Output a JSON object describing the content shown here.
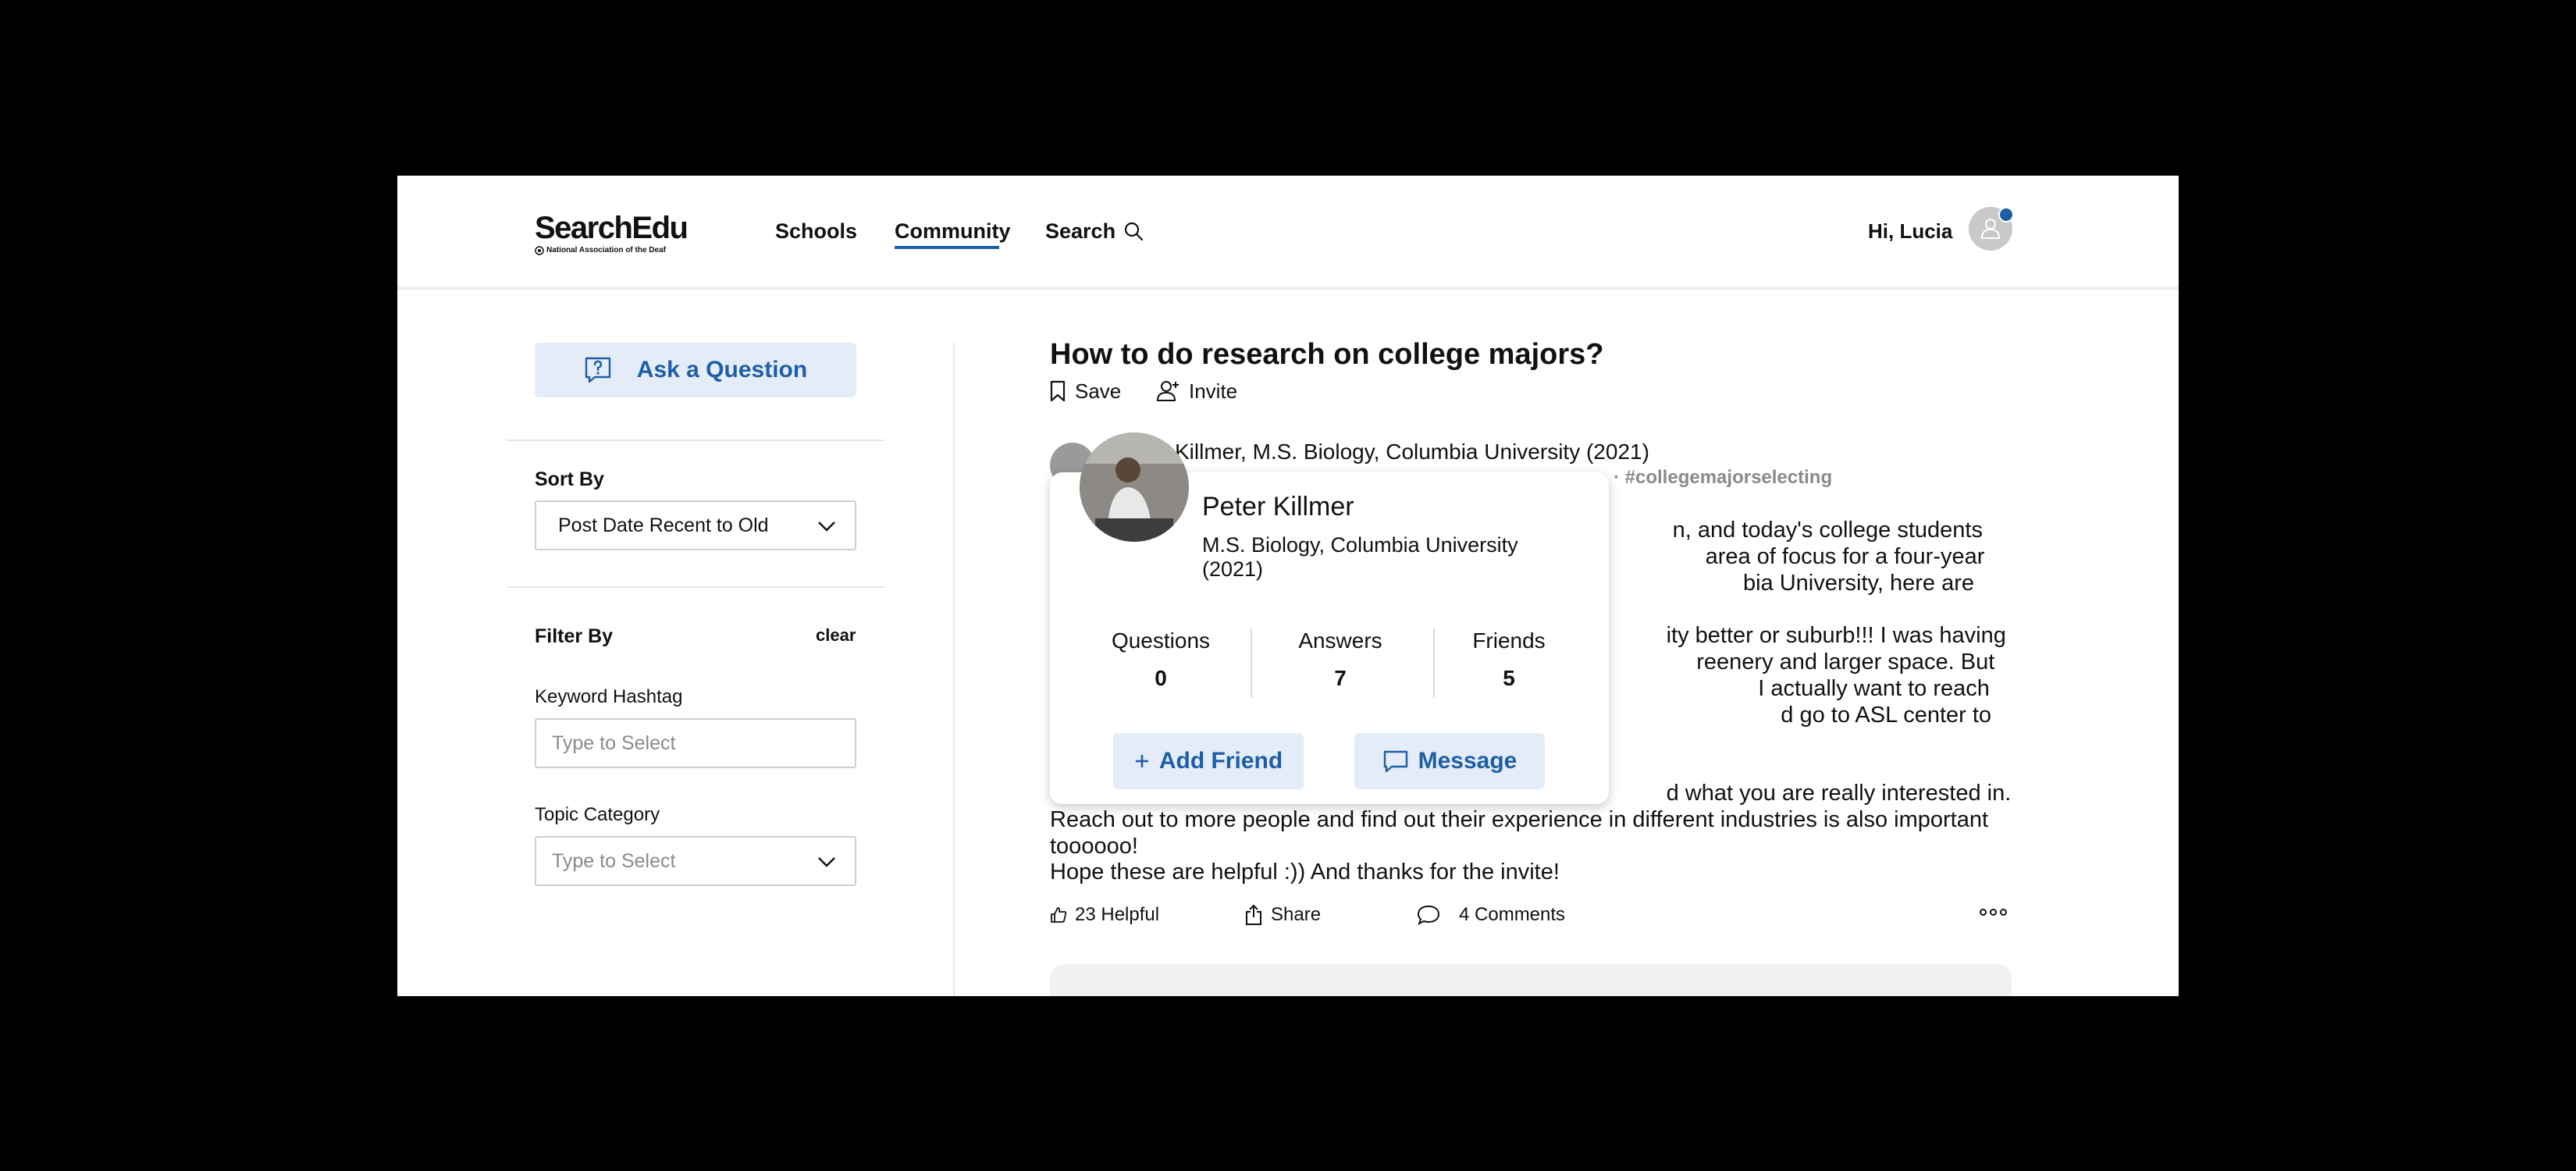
{
  "header": {
    "logo_title": "SearchEdu",
    "logo_subtitle": "National Association of the Deaf",
    "nav": {
      "schools": "Schools",
      "community": "Community",
      "search": "Search"
    },
    "greeting": "Hi, Lucia"
  },
  "sidebar": {
    "ask_label": "Ask a Question",
    "sort_label": "Sort By",
    "sort_value": "Post Date Recent to Old",
    "filter_label": "Filter By",
    "clear_label": "clear",
    "keyword_label": "Keyword Hashtag",
    "keyword_placeholder": "Type to Select",
    "topic_label": "Topic Category",
    "topic_placeholder": "Type to Select"
  },
  "post": {
    "title": "How to do research on college majors?",
    "save_label": "Save",
    "invite_label": "Invite",
    "author_line": "Killmer, M.S. Biology, Columbia University (2021)",
    "tag_line": "· #collegemajorselecting",
    "paragraph1": "                                                                                                   n, and today's college students are                                                                                                   area of focus for a four-year degree                                                                                                   bia University, here are some tips!!!",
    "paragraph2": "                                                                                                  ity better or suburb!!! I was having my                                                                                                  reenery and larger space. But not until I                                                                                                  I actually want to reach out to more                                                                                                  d go to ASL center to chat with friends",
    "paragraph3": "                                                                                                  d what you are really interested in. Reach out to more people and find out their experience in different industries is also important toooooo!",
    "paragraph4": "Hope these are helpful :)) And thanks for the invite!",
    "helpful_label": "23 Helpful",
    "share_label": "Share",
    "comments_label": "4 Comments"
  },
  "profile_card": {
    "name": "Peter Killmer",
    "degree": "M.S. Biology, Columbia University (2021)",
    "stats": [
      {
        "label": "Questions",
        "value": "0"
      },
      {
        "label": "Answers",
        "value": "7"
      },
      {
        "label": "Friends",
        "value": "5"
      }
    ],
    "add_friend_label": "Add Friend",
    "message_label": "Message"
  },
  "colors": {
    "accent": "#1e5ea8",
    "button_bg": "#e4edf7"
  }
}
